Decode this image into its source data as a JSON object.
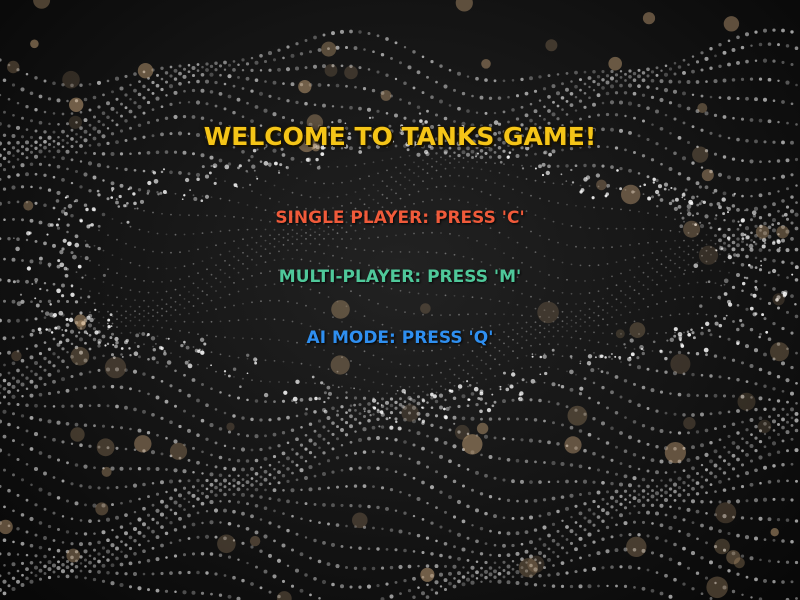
{
  "colors": {
    "background": "#111111",
    "title": "#f5c518",
    "single": "#f05a3a",
    "multi": "#4fc89a",
    "ai": "#2f8ff0",
    "dots": "#d8d8d8",
    "bokeh": "#c9a57a"
  },
  "menu": {
    "title": "WELCOME TO TANKS GAME!",
    "options": [
      {
        "label": "SINGLE PLAYER: PRESS 'C'",
        "key": "C"
      },
      {
        "label": "MULTI-PLAYER: PRESS 'M'",
        "key": "M"
      },
      {
        "label": "AI  MODE: PRESS 'Q'",
        "key": "Q"
      }
    ]
  }
}
